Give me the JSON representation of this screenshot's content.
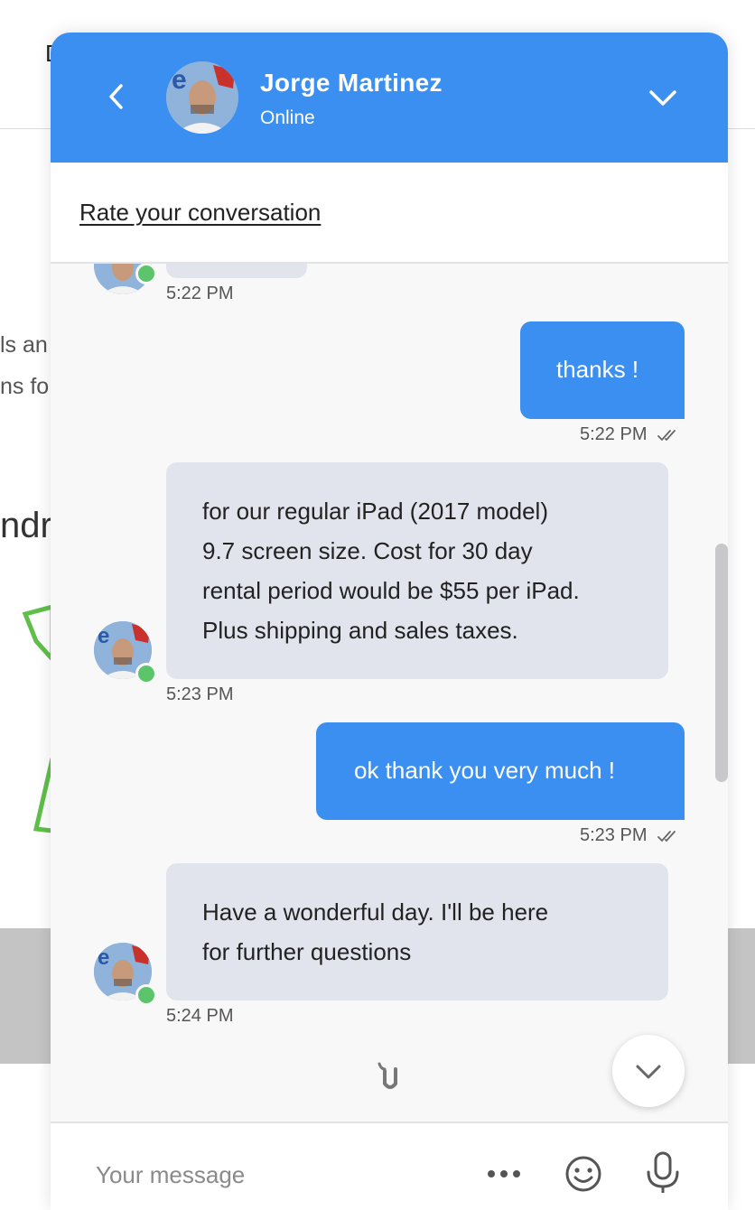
{
  "background": {
    "top_letter": "D",
    "line1": "ls an",
    "line2": "ns fo",
    "heading": "ndr"
  },
  "header": {
    "agent_name": "Jorge Martinez",
    "status": "Online"
  },
  "rate": {
    "label": "Rate your conversation"
  },
  "messages": [
    {
      "from": "agent",
      "lines": [],
      "time": "5:22 PM"
    },
    {
      "from": "user",
      "text": "thanks !",
      "time": "5:22 PM",
      "read": true
    },
    {
      "from": "agent",
      "lines": [
        "for our regular iPad (2017 model)",
        "9.7 screen size. Cost for 30 day",
        "rental period would be $55 per iPad.",
        "Plus shipping and sales taxes."
      ],
      "time": "5:23 PM"
    },
    {
      "from": "user",
      "text": "ok thank you very much !",
      "time": "5:23 PM",
      "read": true
    },
    {
      "from": "agent",
      "lines": [
        "Have a wonderful day. I'll be here",
        "for further questions"
      ],
      "time": "5:24 PM"
    }
  ],
  "composer": {
    "placeholder": "Your message"
  },
  "icons": {
    "back": "chevron-left-icon",
    "collapse": "chevron-down-icon",
    "scroll_down": "chevron-down-icon",
    "more": "more-dots-icon",
    "emoji": "emoji-icon",
    "mic": "microphone-icon",
    "read": "double-check-icon"
  },
  "colors": {
    "brand": "#3a8ff0",
    "agent_bubble": "#e1e4ec",
    "online": "#5cc46a"
  }
}
